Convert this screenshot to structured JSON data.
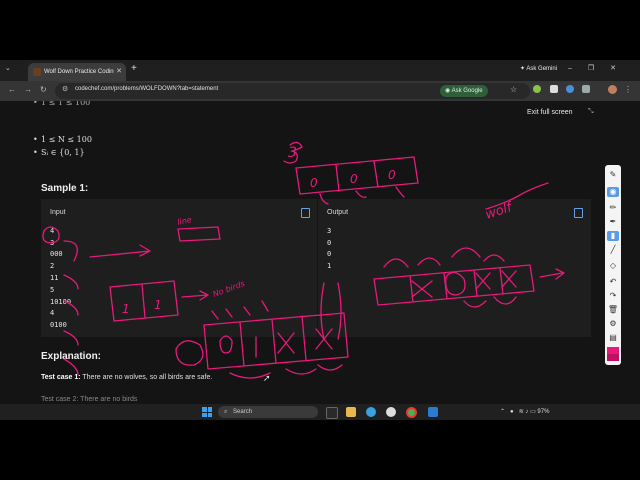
{
  "browser": {
    "tab_title": "Wolf Down Practice Coding Pro",
    "new_tab_symbol": "+",
    "ask_gemini": "Ask Gemini",
    "url": "codechef.com/problems/WOLFDOWN?tab=statement",
    "ask_google": "Ask Google"
  },
  "page": {
    "exit_full_screen": "Exit full screen",
    "constraints": [
      "1 ≤ N ≤ 100",
      "Sᵢ ∈ {0, 1}"
    ],
    "sample_title": "Sample 1:",
    "input_label": "Input",
    "output_label": "Output",
    "input_lines": [
      "4",
      "3",
      "000",
      "2",
      "11",
      "5",
      "10100",
      "4",
      "0100"
    ],
    "output_lines": [
      "3",
      "0",
      "0",
      "1"
    ],
    "explanation_title": "Explanation:",
    "test_case_1_label": "Test case 1:",
    "test_case_1_text": "There are no wolves, so all birds are safe."
  },
  "annotations": {
    "wolf": "wolf",
    "no_birds": "No birds",
    "line": "line",
    "cell_one": "1",
    "cell_zero": "0",
    "three": "3"
  },
  "taskbar": {
    "search_placeholder": "Search",
    "battery": "97%"
  },
  "colors": {
    "annotation_pen": "#e8197a",
    "page_bg": "#141414",
    "box_bg": "#1e1e1e"
  }
}
